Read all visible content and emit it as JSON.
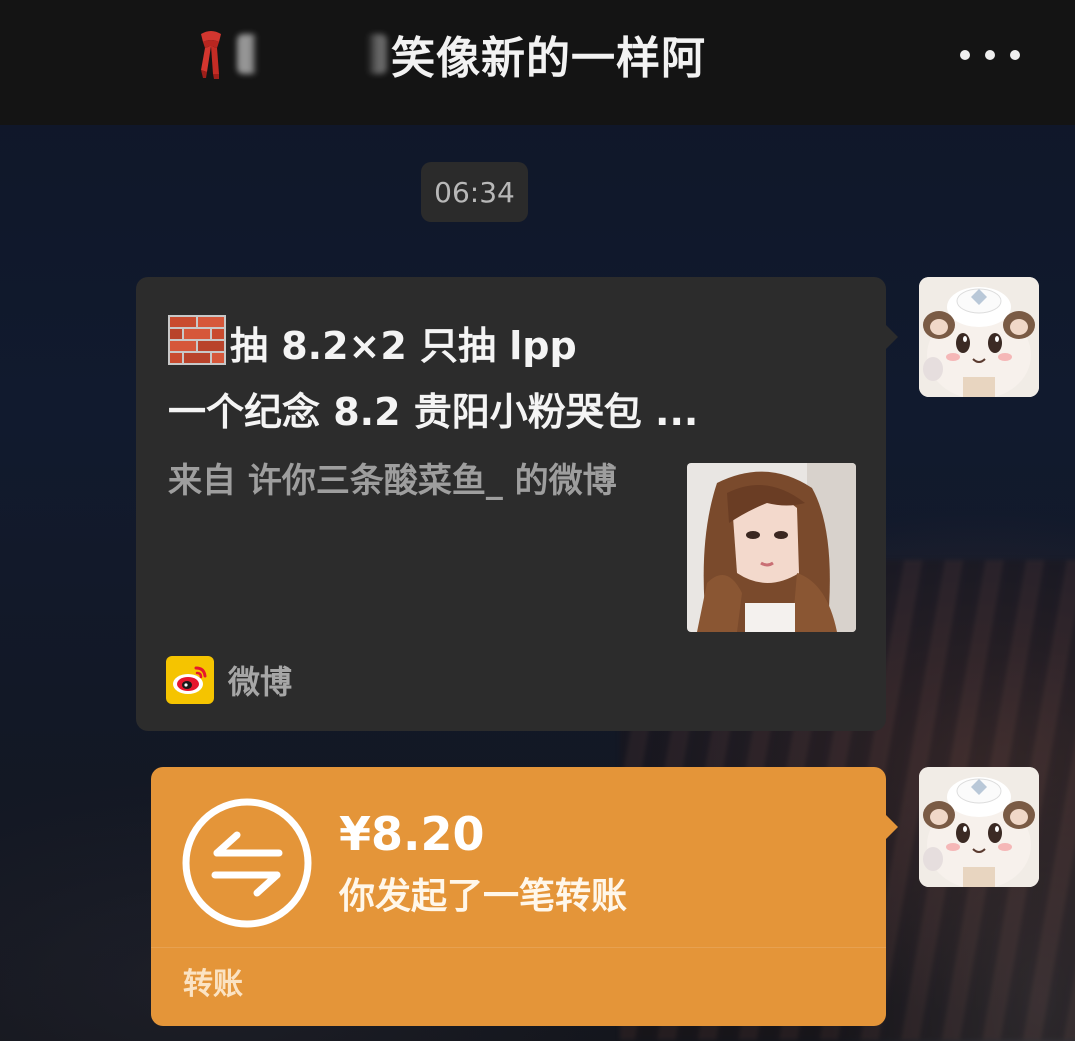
{
  "header": {
    "title": "笑像新的一样阿",
    "more_icon": "more-dots-icon"
  },
  "timestamp": "06:34",
  "share_card": {
    "title_line1": "抽 8.2×2 只抽 lpp",
    "title_line2": "一个纪念 8.2 贵阳小粉哭包 ...",
    "source_text": "来自 许你三条酸菜鱼_ 的微博",
    "footer_label": "微博",
    "leading_icon": "brick-wall-icon",
    "footer_icon": "weibo-icon"
  },
  "transfer": {
    "amount": "¥8.20",
    "description": "你发起了一笔转账",
    "label": "转账",
    "icon": "transfer-arrows-icon",
    "color": "#e49539"
  },
  "colors": {
    "header_bg": "#141414",
    "card_bg": "#2c2c2c",
    "timestamp_bg": "#2b2b2b"
  }
}
